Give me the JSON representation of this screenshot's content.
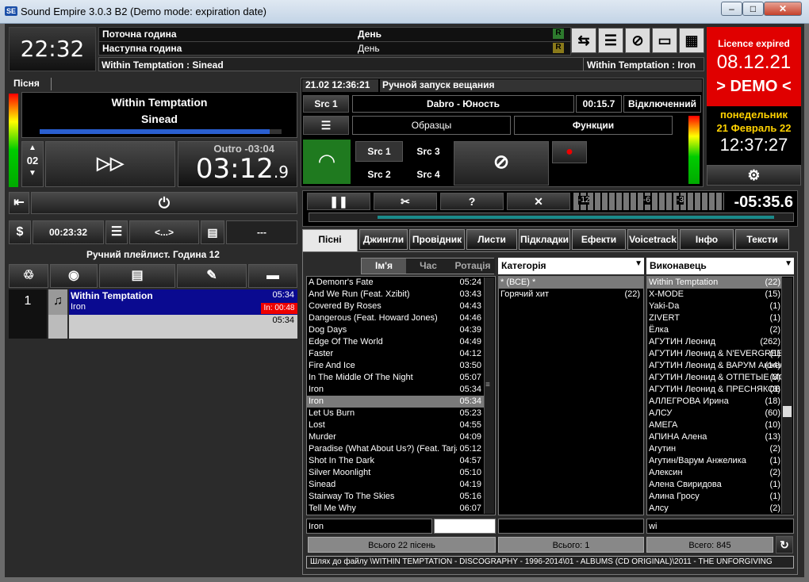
{
  "window": {
    "title": "Sound Empire 3.0.3 B2  (Demo mode: expiration date)",
    "min": "–",
    "max": "□",
    "close": "✕",
    "app_icon": "SE"
  },
  "clock": {
    "time": "22:32"
  },
  "header": {
    "current_hour_label": "Поточна година",
    "current_hour_value": "День",
    "current_flag": "R",
    "next_hour_label": "Наступна година",
    "next_hour_value": "День",
    "next_flag": "R",
    "now_playing": "Within Temptation : Sinead",
    "next_playing": "Within Temptation : Iron"
  },
  "licence": {
    "title": "Licence expired",
    "date": "08.12.21",
    "demo": "> DEMO <",
    "weekday": "понедельник",
    "date_long": "21 Февраль 22",
    "time": "12:37:27"
  },
  "player": {
    "tab": "Пісня",
    "artist": "Within Temptation",
    "title": "Sinead",
    "counter": "02",
    "outro": "Outro -03:04",
    "remain_main": "03:12",
    "remain_frac": ".9",
    "progress": 0.95
  },
  "broadcast": {
    "datetime": "21.02 12:36:21",
    "status": "Ручной запуск вещания",
    "src_label": "Src 1",
    "track": "Dabro - Юность",
    "elapsed": "00:15.7",
    "state": "Відключенний",
    "samples": "Образцы",
    "functions": "Функции",
    "src1": "Src 1",
    "src2": "Src 2",
    "src3": "Src 3",
    "src4": "Src 4"
  },
  "transport": {
    "remaining": "-05:35.6",
    "vu_labels": [
      "-12",
      "-6",
      "-3"
    ]
  },
  "left_controls": {
    "total_time": "00:23:32",
    "nav": "<...>",
    "dashes": "---",
    "playlist_title": "Ручний плейлист. Година 12"
  },
  "playlist": [
    {
      "index": "1",
      "artist": "Within Temptation",
      "title": "Iron",
      "duration": "05:34",
      "intro": "In: 00:48"
    },
    {
      "index": "",
      "artist": "",
      "title": "",
      "duration": "05:34",
      "intro": ""
    }
  ],
  "tabs": [
    "Пісні",
    "Джингли",
    "Провідник",
    "Листи",
    "Підкладки",
    "Ефекти",
    "Voicetrack",
    "Інфо",
    "Тексти"
  ],
  "songs": {
    "sort_name": "Ім'я",
    "sort_time": "Час",
    "sort_rotation": "Ротація",
    "filter": "Iron",
    "total": "Всього 22 пісень",
    "items": [
      {
        "name": "A Demonr's Fate",
        "time": "05:24"
      },
      {
        "name": "And We Run (Feat. Xzibit)",
        "time": "03:43"
      },
      {
        "name": "Covered By Roses",
        "time": "04:43"
      },
      {
        "name": "Dangerous (Feat. Howard Jones)",
        "time": "04:46"
      },
      {
        "name": "Dog Days",
        "time": "04:39"
      },
      {
        "name": "Edge Of The World",
        "time": "04:49"
      },
      {
        "name": "Faster",
        "time": "04:12"
      },
      {
        "name": "Fire And Ice",
        "time": "03:50"
      },
      {
        "name": "In The Middle Of The Night",
        "time": "05:07"
      },
      {
        "name": "Iron",
        "time": "05:34"
      },
      {
        "name": "Iron",
        "time": "05:34"
      },
      {
        "name": "Let Us Burn",
        "time": "05:23"
      },
      {
        "name": "Lost",
        "time": "04:55"
      },
      {
        "name": "Murder",
        "time": "04:09"
      },
      {
        "name": "Paradise (What About Us?) (Feat. Tarja)",
        "time": "05:12"
      },
      {
        "name": "Shot In The Dark",
        "time": "04:57"
      },
      {
        "name": "Silver Moonlight",
        "time": "05:10"
      },
      {
        "name": "Sinead",
        "time": "04:19"
      },
      {
        "name": "Stairway To The Skies",
        "time": "05:16"
      },
      {
        "name": "Tell Me Why",
        "time": "06:07"
      }
    ]
  },
  "categories": {
    "header": "Категорія",
    "total": "Всього: 1",
    "items": [
      {
        "name": "* (ВСЕ) *",
        "count": ""
      },
      {
        "name": "Горячий хит",
        "count": "(22)"
      }
    ]
  },
  "artists": {
    "header": "Виконавець",
    "filter": "wi",
    "total": "Всего: 845",
    "items": [
      {
        "name": "Within Temptation",
        "count": "(22)"
      },
      {
        "name": "X-MODE",
        "count": "(15)"
      },
      {
        "name": "Yaki-Da",
        "count": "(1)"
      },
      {
        "name": "ZIVERT",
        "count": "(1)"
      },
      {
        "name": "Ёлка",
        "count": "(2)"
      },
      {
        "name": "АГУТИН Леонид",
        "count": "(262)"
      },
      {
        "name": "АГУТИН Леонид & N'EVERGREEN",
        "count": "(1)"
      },
      {
        "name": "АГУТИН Леонид & ВАРУМ Анжелика",
        "count": "(14)"
      },
      {
        "name": "АГУТИН Леонид & ОТПЕТЫЕ МОШЕННИКИ",
        "count": "(3)"
      },
      {
        "name": "АГУТИН Леонид & ПРЕСНЯКОВ",
        "count": "(3)"
      },
      {
        "name": "АЛЛЕГРОВА Ирина",
        "count": "(18)"
      },
      {
        "name": "АЛСУ",
        "count": "(60)"
      },
      {
        "name": "АМЕГА",
        "count": "(10)"
      },
      {
        "name": "АПИНА Алена",
        "count": "(13)"
      },
      {
        "name": "Агутин",
        "count": "(2)"
      },
      {
        "name": "Агутин/Варум Анжелика",
        "count": "(1)"
      },
      {
        "name": "Алексин",
        "count": "(2)"
      },
      {
        "name": "Алена Свиридова",
        "count": "(1)"
      },
      {
        "name": "Алина Гросу",
        "count": "(1)"
      },
      {
        "name": "Алсу",
        "count": "(2)"
      }
    ]
  },
  "path": "Шлях до файлу \\WITHIN TEMPTATION - DISCOGRAPHY - 1996-2014\\01 - ALBUMS (CD ORIGINAL)\\2011 - THE UNFORGIVING"
}
